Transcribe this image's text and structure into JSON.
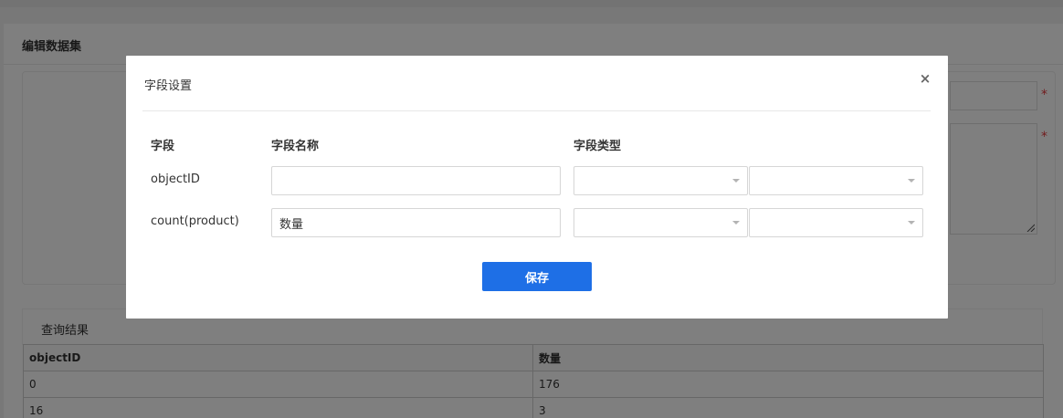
{
  "page": {
    "panel_title": "编辑数据集",
    "required_mark": "*",
    "result_tab_label": "查询结果",
    "result_table": {
      "headers": [
        "objectID",
        "数量"
      ],
      "rows": [
        [
          "0",
          "176"
        ],
        [
          "16",
          "3"
        ]
      ]
    }
  },
  "modal": {
    "title": "字段设置",
    "close_symbol": "×",
    "columns": {
      "field": "字段",
      "field_name": "字段名称",
      "field_type": "字段类型"
    },
    "rows": [
      {
        "field": "objectID",
        "name_value": "",
        "type_a": "",
        "type_b": ""
      },
      {
        "field": "count(product)",
        "name_value": "数量",
        "type_a": "",
        "type_b": ""
      }
    ],
    "save_label": "保存"
  },
  "colors": {
    "primary": "#1e6fe6",
    "required": "#e4393c",
    "overlay": "rgba(0,0,0,0.50)"
  }
}
